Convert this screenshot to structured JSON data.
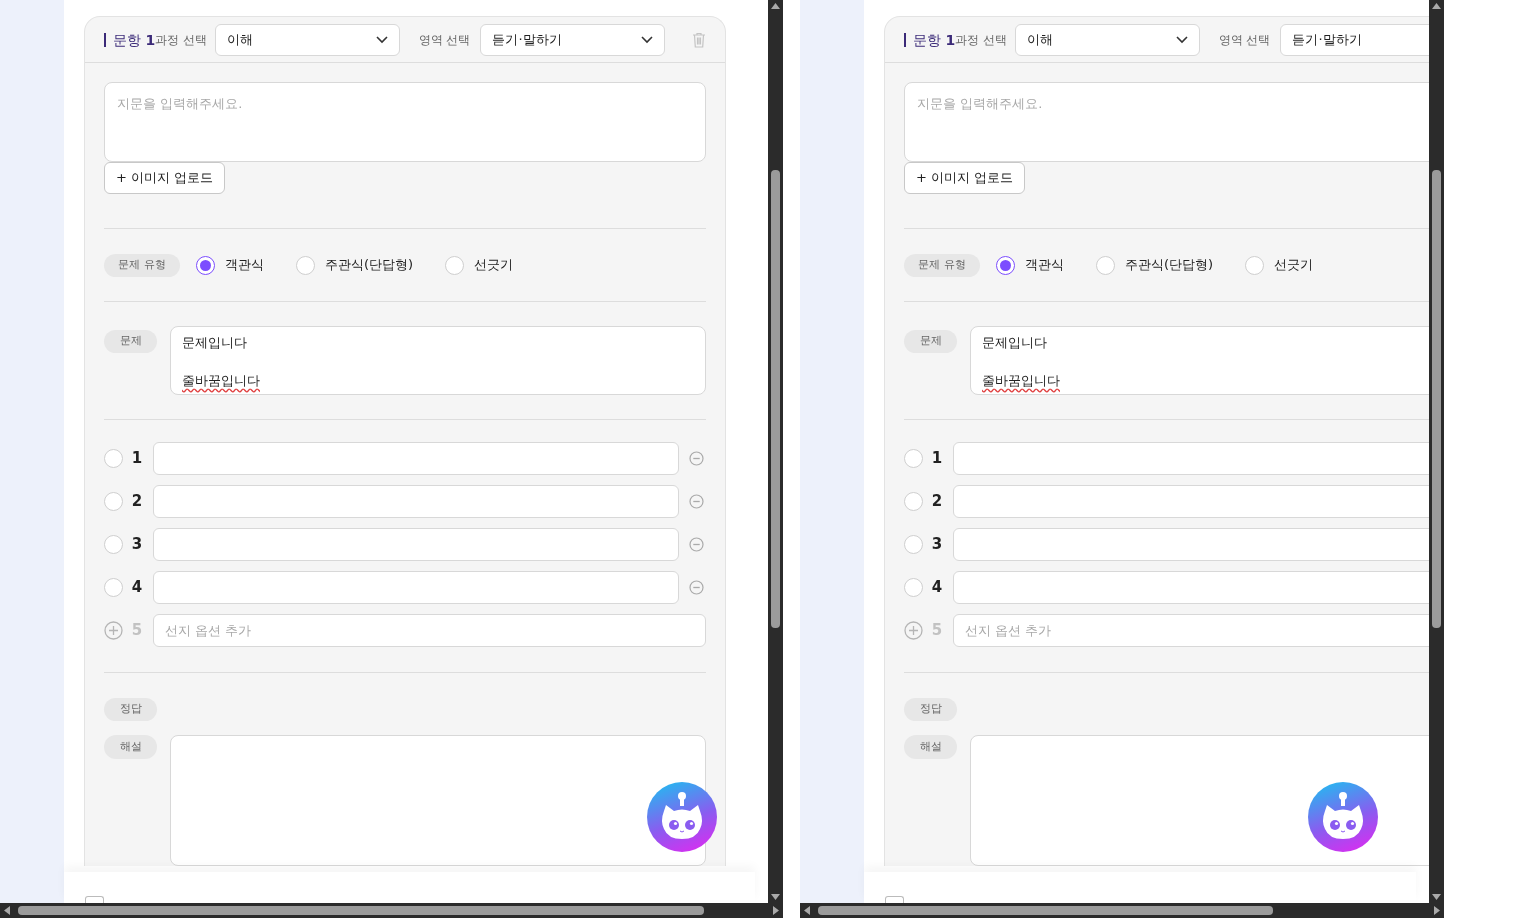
{
  "panes": [
    {
      "question_label": "문항",
      "question_number": "1",
      "course_label": "과정 선택",
      "course_value": "이해",
      "area_label": "영역 선택",
      "area_value": "듣기·말하기",
      "passage_placeholder": "지문을 입력해주세요.",
      "upload_button": "+ 이미지 업로드",
      "type_label": "문제 유형",
      "types": [
        {
          "label": "객관식",
          "selected": true
        },
        {
          "label": "주관식(단답형)",
          "selected": false
        },
        {
          "label": "선긋기",
          "selected": false
        }
      ],
      "prompt_label": "문제",
      "prompt_lines": [
        {
          "text": "문제입니다",
          "misspelled": false
        },
        {
          "text": "줄바꿈입니다",
          "misspelled": true
        }
      ],
      "options": [
        {
          "number": "1",
          "selected": false
        },
        {
          "number": "2",
          "selected": false
        },
        {
          "number": "3",
          "selected": false
        },
        {
          "number": "4",
          "selected": false
        }
      ],
      "add_option": {
        "number": "5",
        "placeholder": "선지 옵션 추가"
      },
      "answer_label": "정답",
      "explanation_label": "해설",
      "footer_checkbox": {
        "checked": false
      }
    },
    {
      "question_label": "문항",
      "question_number": "1",
      "course_label": "과정 선택",
      "course_value": "이해",
      "area_label": "영역 선택",
      "area_value": "듣기·말하기",
      "passage_placeholder": "지문을 입력해주세요.",
      "upload_button": "+ 이미지 업로드",
      "type_label": "문제 유형",
      "types": [
        {
          "label": "객관식",
          "selected": true
        },
        {
          "label": "주관식(단답형)",
          "selected": false
        },
        {
          "label": "선긋기",
          "selected": false
        }
      ],
      "prompt_label": "문제",
      "prompt_lines": [
        {
          "text": "문제입니다",
          "misspelled": false
        },
        {
          "text": "줄바꿈입니다",
          "misspelled": true
        }
      ],
      "options": [
        {
          "number": "1",
          "selected": false
        },
        {
          "number": "2",
          "selected": false
        },
        {
          "number": "3",
          "selected": false
        },
        {
          "number": "4",
          "selected": false
        }
      ],
      "add_option": {
        "number": "5",
        "placeholder": "선지 옵션 추가"
      },
      "answer_label": "정답",
      "explanation_label": "해설",
      "footer_checkbox": {
        "checked": false
      }
    }
  ]
}
